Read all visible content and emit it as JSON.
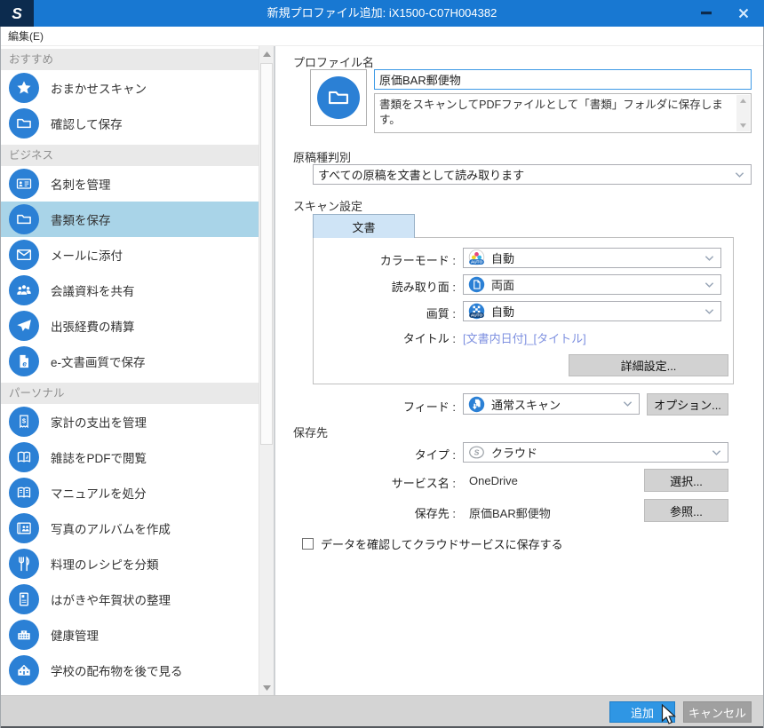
{
  "colors": {
    "titlebar": "#1878d2",
    "accent_blue": "#2b80d5",
    "selected_item_bg": "#a9d4e8",
    "add_button": "#2f96e4",
    "link_text": "#7e90e0"
  },
  "window": {
    "title": "新規プロファイル追加: iX1500-C07H004382",
    "menu_edit": "編集(E)"
  },
  "sidebar": {
    "sections": [
      {
        "header": "おすすめ",
        "items": [
          {
            "label": "おまかせスキャン",
            "icon": "star-icon"
          },
          {
            "label": "確認して保存",
            "icon": "folder-icon"
          }
        ]
      },
      {
        "header": "ビジネス",
        "items": [
          {
            "label": "名刺を管理",
            "icon": "business-card-icon"
          },
          {
            "label": "書類を保存",
            "icon": "folder-icon",
            "selected": true
          },
          {
            "label": "メールに添付",
            "icon": "mail-icon"
          },
          {
            "label": "会議資料を共有",
            "icon": "people-icon"
          },
          {
            "label": "出張経費の精算",
            "icon": "airplane-icon"
          },
          {
            "label": "e-文書画質で保存",
            "icon": "e-document-icon"
          }
        ]
      },
      {
        "header": "パーソナル",
        "items": [
          {
            "label": "家計の支出を管理",
            "icon": "receipt-icon"
          },
          {
            "label": "雑誌をPDFで閲覧",
            "icon": "magazine-icon"
          },
          {
            "label": "マニュアルを処分",
            "icon": "open-book-icon"
          },
          {
            "label": "写真のアルバムを作成",
            "icon": "photo-album-icon"
          },
          {
            "label": "料理のレシピを分類",
            "icon": "cutlery-icon"
          },
          {
            "label": "はがきや年賀状の整理",
            "icon": "postcard-icon"
          },
          {
            "label": "健康管理",
            "icon": "hospital-icon"
          },
          {
            "label": "学校の配布物を後で見る",
            "icon": "school-icon"
          }
        ]
      }
    ]
  },
  "main": {
    "profile_name_label": "プロファイル名",
    "profile_name_value": "原価BAR郵便物",
    "profile_description": "書類をスキャンしてPDFファイルとして「書類」フォルダに保存します。",
    "doc_type_label": "原稿種判別",
    "doc_type_value": "すべての原稿を文書として読み取ります",
    "scan_settings_label": "スキャン設定",
    "tab_label": "文書",
    "scan": {
      "color_mode_label": "カラーモード :",
      "color_mode_value": "自動",
      "scan_side_label": "読み取り面 :",
      "scan_side_value": "両面",
      "quality_label": "画質 :",
      "quality_value": "自動",
      "title_label": "タイトル :",
      "title_value": "[文書内日付]_[タイトル]",
      "detail_button": "詳細設定...",
      "feed_label": "フィード :",
      "feed_value": "通常スキャン",
      "option_button": "オプション..."
    },
    "save": {
      "header": "保存先",
      "type_label": "タイプ :",
      "type_value": "クラウド",
      "service_label": "サービス名 :",
      "service_value": "OneDrive",
      "select_button": "選択...",
      "dest_label": "保存先 :",
      "dest_value": "原価BAR郵便物",
      "browse_button": "参照...",
      "checkbox_label": "データを確認してクラウドサービスに保存する"
    }
  },
  "footer": {
    "add_button": "追加",
    "cancel_button": "キャンセル"
  }
}
